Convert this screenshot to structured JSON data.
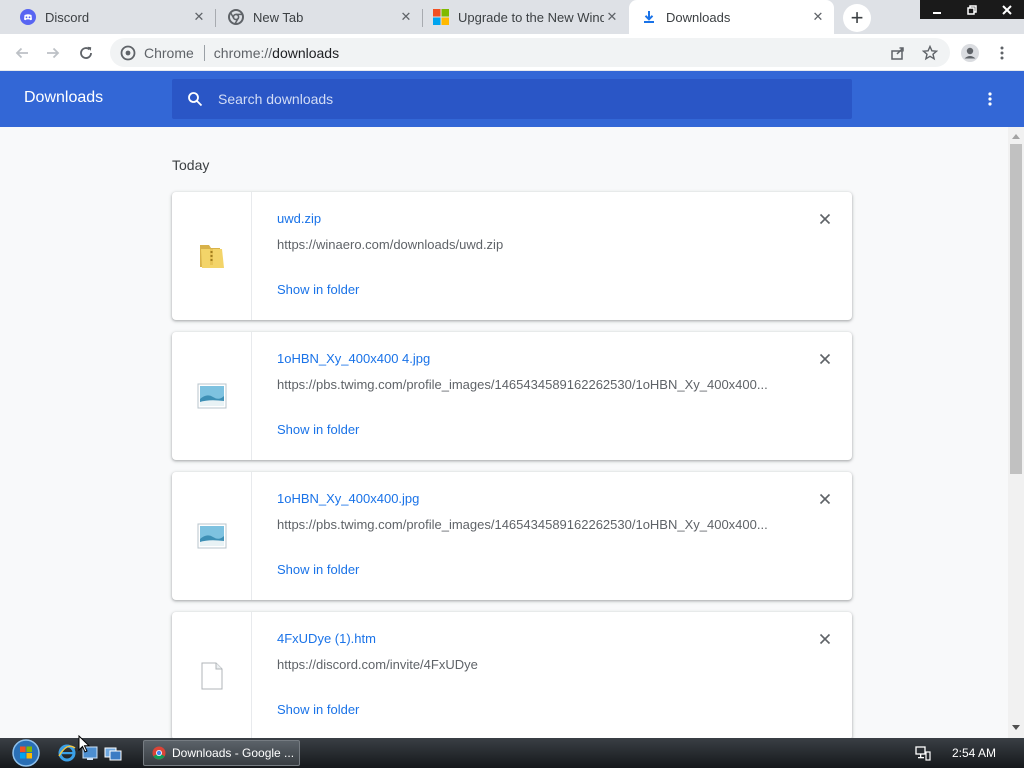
{
  "tabs": [
    {
      "title": "Discord",
      "favicon": "discord-icon",
      "active": false
    },
    {
      "title": "New Tab",
      "favicon": "chrome-icon",
      "active": false
    },
    {
      "title": "Upgrade to the New Wind",
      "favicon": "microsoft-icon",
      "active": false
    },
    {
      "title": "Downloads",
      "favicon": "download-icon",
      "active": true
    }
  ],
  "omnibox": {
    "site_label": "Chrome",
    "url_scheme": "chrome://",
    "url_host": "downloads"
  },
  "downloads": {
    "title": "Downloads",
    "search_placeholder": "Search downloads",
    "section_date": "Today",
    "items": [
      {
        "name": "uwd.zip",
        "url": "https://winaero.com/downloads/uwd.zip",
        "action": "Show in folder",
        "file_icon": "zip-folder-icon"
      },
      {
        "name": "1oHBN_Xy_400x400 4.jpg",
        "url": "https://pbs.twimg.com/profile_images/1465434589162262530/1oHBN_Xy_400x400...",
        "action": "Show in folder",
        "file_icon": "image-file-icon"
      },
      {
        "name": "1oHBN_Xy_400x400.jpg",
        "url": "https://pbs.twimg.com/profile_images/1465434589162262530/1oHBN_Xy_400x400...",
        "action": "Show in folder",
        "file_icon": "image-file-icon"
      },
      {
        "name": "4FxUDye (1).htm",
        "url": "https://discord.com/invite/4FxUDye",
        "action": "Show in folder",
        "file_icon": "blank-file-icon"
      }
    ]
  },
  "taskbar": {
    "task_label": "Downloads - Google ...",
    "clock": "2:54 AM"
  },
  "colors": {
    "header_blue": "#3367d6",
    "search_blue": "#2a56c6",
    "link_blue": "#1a73e8",
    "discord": "#5865f2"
  }
}
